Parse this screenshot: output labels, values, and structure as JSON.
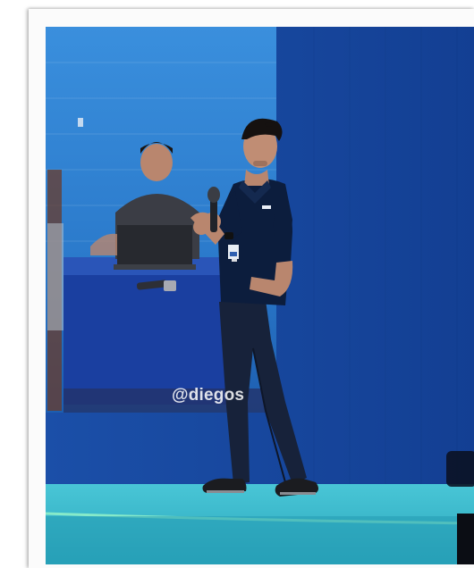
{
  "photo": {
    "screen_handle": "@diegos",
    "colors": {
      "backdrop": "#123f96",
      "screen": "#2f7fd1",
      "stage": "#36b6c9",
      "stage_light": "#7ee6c6",
      "shirt": "#0c1d3d",
      "jeans": "#17223a"
    }
  }
}
